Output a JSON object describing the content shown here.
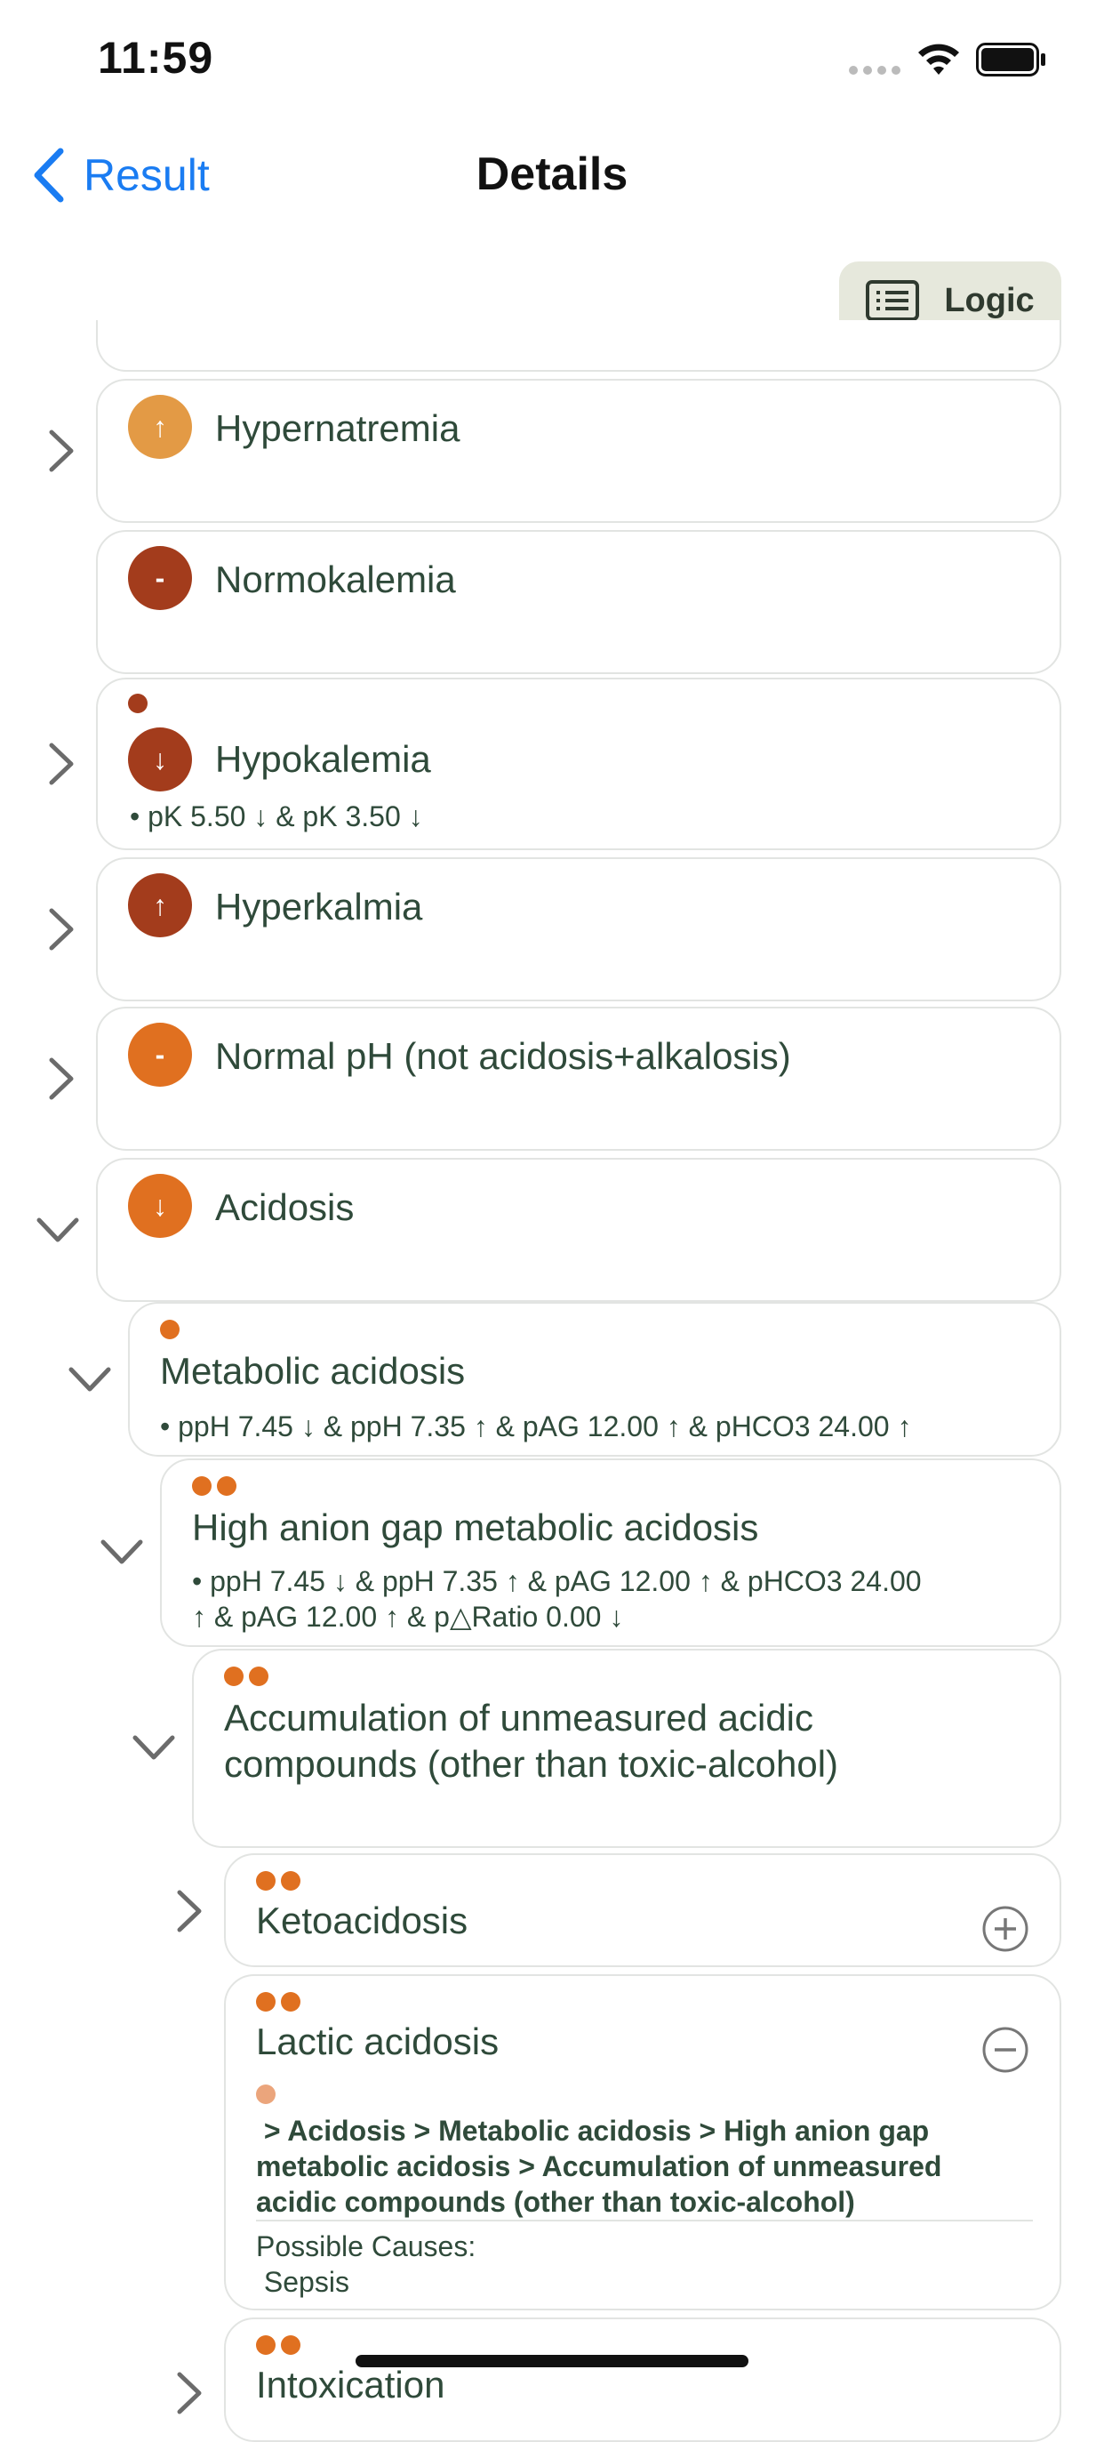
{
  "status": {
    "time": "11:59"
  },
  "nav": {
    "back_label": "Result",
    "title": "Details"
  },
  "toolbar": {
    "logic_label": "Logic"
  },
  "items": [
    {
      "symbol": "↑",
      "title": "Hypernatremia"
    },
    {
      "symbol": "-",
      "title": "Normokalemia"
    },
    {
      "symbol": "↓",
      "title": "Hypokalemia",
      "rule": "• pK 5.50 ↓ & pK 3.50 ↓"
    },
    {
      "symbol": "↑",
      "title": "Hyperkalmia"
    },
    {
      "symbol": "-",
      "title": "Normal pH (not acidosis+alkalosis)"
    },
    {
      "symbol": "↓",
      "title": "Acidosis"
    }
  ],
  "tree": {
    "metabolic": {
      "title": "Metabolic acidosis",
      "rule": "• ppH 7.45 ↓ & ppH 7.35 ↑ & pAG 12.00 ↑ & pHCO3 24.00 ↑"
    },
    "high_ag": {
      "title": "High anion gap metabolic acidosis",
      "rule_line1": "• ppH 7.45 ↓ & ppH 7.35 ↑ & pAG 12.00 ↑ & pHCO3 24.00",
      "rule_line2": "↑ & pAG 12.00 ↑ & p△Ratio 0.00 ↓"
    },
    "accumulation": {
      "title_line1": "Accumulation of unmeasured acidic",
      "title_line2": "compounds (other than toxic-alcohol)"
    },
    "keto": {
      "title": "Ketoacidosis"
    },
    "lactic": {
      "title": "Lactic acidosis",
      "path_line1": " > Acidosis > Metabolic acidosis > High anion gap",
      "path_line2": "metabolic acidosis > Accumulation of unmeasured",
      "path_line3": "acidic compounds (other than toxic-alcohol)",
      "causes_label": "Possible Causes:",
      "cause": " Sepsis"
    },
    "intox": {
      "title": "Intoxication"
    }
  },
  "colors": {
    "accent_blue": "#1a7cf2",
    "orange_light": "#e39a45",
    "orange": "#e07020",
    "brown": "#a33c1c",
    "dot_light": "#eba57c"
  }
}
